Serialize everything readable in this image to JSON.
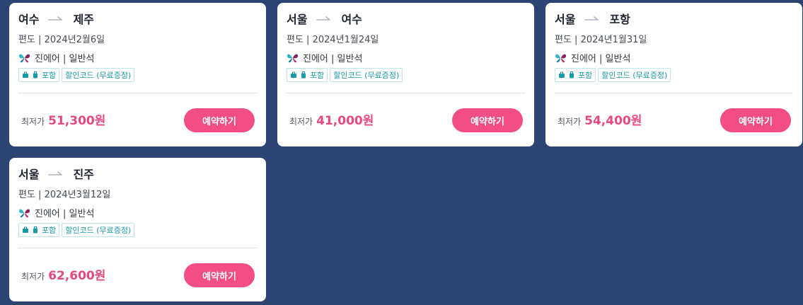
{
  "cards": [
    {
      "from": "여수",
      "to": "제주",
      "meta": "편도 | 2024년2월6일",
      "airline": "진에어 | 일반석",
      "tag_baggage": "포함",
      "tag_coupon": "할인코드 (무료증정)",
      "price_label": "최저가",
      "price": "51,300원",
      "book_label": "예약하기"
    },
    {
      "from": "서울",
      "to": "여수",
      "meta": "편도 | 2024년1월24일",
      "airline": "진에어 | 일반석",
      "tag_baggage": "포함",
      "tag_coupon": "할인코드 (무료증정)",
      "price_label": "최저가",
      "price": "41,000원",
      "book_label": "예약하기"
    },
    {
      "from": "서울",
      "to": "포항",
      "meta": "편도 | 2024년1월31일",
      "airline": "진에어 | 일반석",
      "tag_baggage": "포함",
      "tag_coupon": "할인코드 (무료증정)",
      "price_label": "최저가",
      "price": "54,400원",
      "book_label": "예약하기"
    },
    {
      "from": "서울",
      "to": "진주",
      "meta": "편도 | 2024년3월12일",
      "airline": "진에어 | 일반석",
      "tag_baggage": "포함",
      "tag_coupon": "할인코드 (무료증정)",
      "price_label": "최저가",
      "price": "62,600원",
      "book_label": "예약하기"
    }
  ],
  "colors": {
    "background": "#2b4472",
    "accent_pink": "#f24d84",
    "price_pink": "#e64882",
    "tag_teal": "#1a9aa6"
  },
  "icons": {
    "route_arrow": "arrow-right-icon",
    "airline_logo": "jinair-butterfly-logo-icon",
    "baggage": "suitcase-icon"
  }
}
